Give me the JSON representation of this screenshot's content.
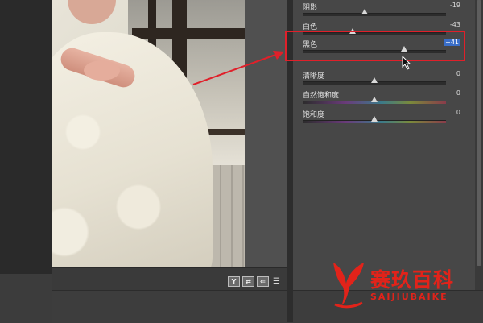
{
  "panel": {
    "sliders": [
      {
        "label": "阴影",
        "value": "-19",
        "position": 0.43
      },
      {
        "label": "白色",
        "value": "-43",
        "position": 0.35
      },
      {
        "label": "黑色",
        "value": "+41",
        "position": 0.71,
        "selected": true
      },
      {
        "label": "清晰度",
        "value": "0",
        "position": 0.5
      },
      {
        "label": "自然饱和度",
        "value": "0",
        "position": 0.5,
        "spectrum": true
      },
      {
        "label": "饱和度",
        "value": "0",
        "position": 0.5,
        "spectrum": true
      }
    ]
  },
  "toolbar": {
    "icons": [
      "y-icon",
      "before-after-swap-icon",
      "copy-settings-icon",
      "preview-settings-icon"
    ],
    "y_label": "Y"
  },
  "watermark": {
    "brand": "赛玖百科",
    "subtitle": "SAIJIUBAIKE"
  },
  "colors": {
    "highlight": "#e0202a",
    "accent": "#3a6ec8",
    "brand": "#e2231a"
  }
}
